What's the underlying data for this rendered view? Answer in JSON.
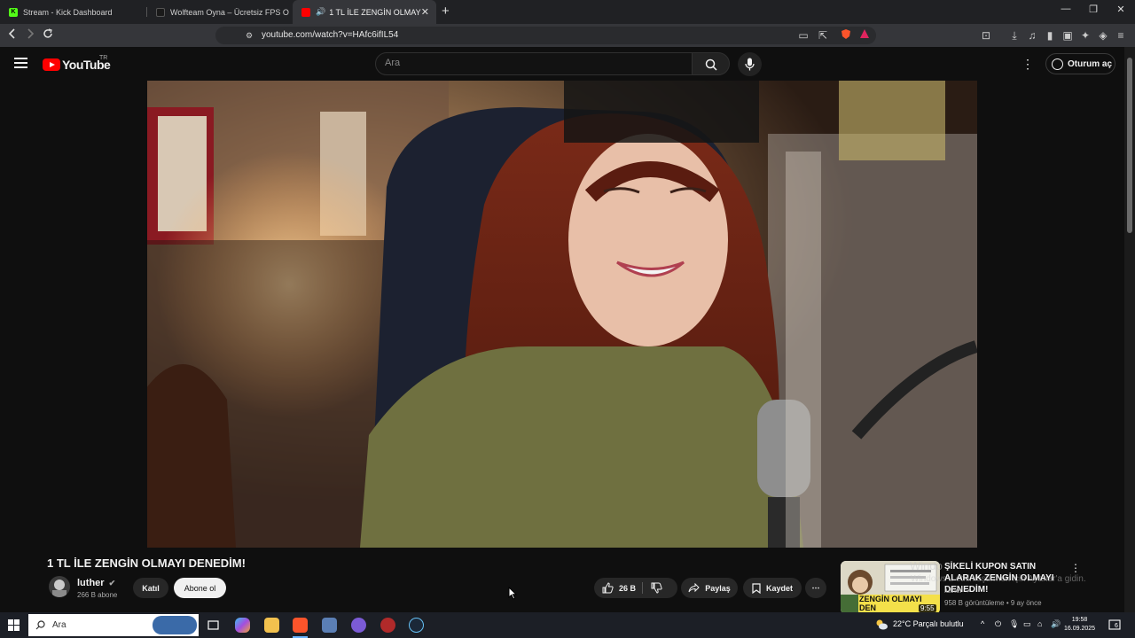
{
  "browser": {
    "tabs": [
      {
        "title": "Stream - Kick Dashboard",
        "icon": "K"
      },
      {
        "title": "Wolfteam Oyna – Ücretsiz FPS Oyunu",
        "icon": "W"
      },
      {
        "title": "1 TL İLE ZENGİN OLMAYI DENEDİM!",
        "icon": "yt"
      }
    ],
    "url": "youtube.com/watch?v=HAfc6ifIL54"
  },
  "youtube": {
    "logo_text": "YouTube",
    "country_code": "TR",
    "search_placeholder": "Ara",
    "signin_label": "Oturum aç"
  },
  "video": {
    "title": "1 TL İLE ZENGİN OLMAYI DENEDİM!",
    "channel": "luther",
    "subscribers": "266 B abone",
    "join_label": "Katıl",
    "subscribe_label": "Abone ol",
    "likes": "26 B",
    "share_label": "Paylaş",
    "save_label": "Kaydet"
  },
  "recommendation": {
    "title": "ŞİKELİ KUPON SATIN ALARAK ZENGİN OLMAYI DENEDİM!",
    "channel": "luther",
    "meta": "958 B görüntüleme • 9 ay önce",
    "duration": "9:55",
    "thumb_text": "ZENGİN OLMAYI DEN"
  },
  "watermark": {
    "line1": "Windo",
    "line2": "Windows'u etkinleştirmek için Ayarlar'a gidin."
  },
  "taskbar": {
    "search_label": "Ara",
    "weather": "22°C  Parçalı bulutlu",
    "time": "19:58",
    "date": "16.09.2025",
    "notif_count": "6"
  }
}
